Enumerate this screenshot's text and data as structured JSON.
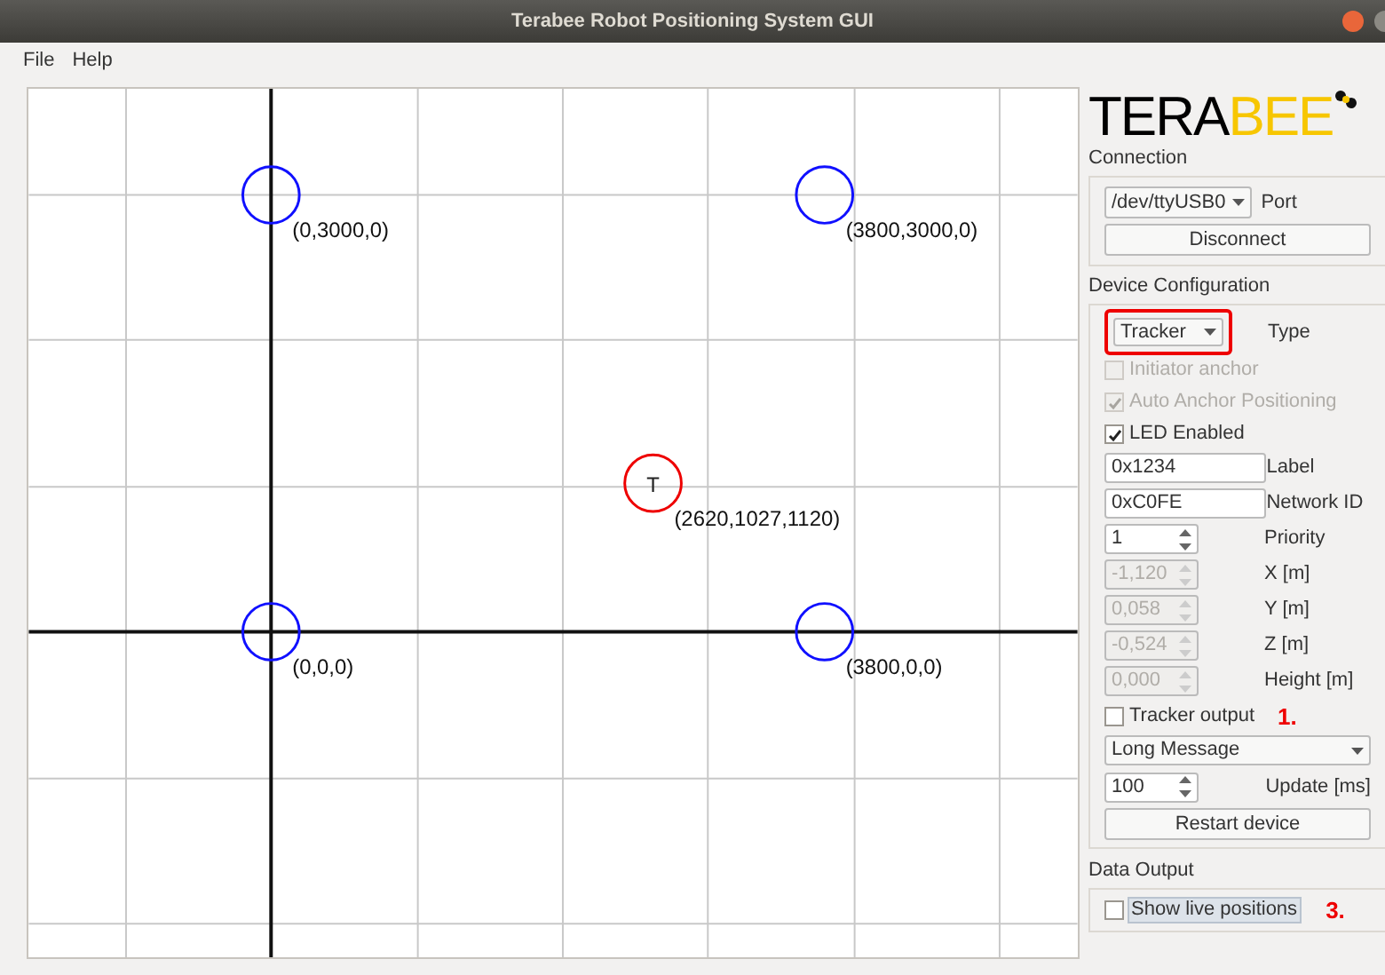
{
  "window": {
    "title": "Terabee Robot Positioning System GUI"
  },
  "menu": [
    "File",
    "Help"
  ],
  "canvas": {
    "anchors": [
      {
        "label": "(0,3000,0)"
      },
      {
        "label": "(3800,3000,0)"
      },
      {
        "label": "(0,0,0)"
      },
      {
        "label": "(3800,0,0)"
      }
    ],
    "tracker": {
      "symbol": "T",
      "label": "(2620,1027,1120)"
    }
  },
  "logo": {
    "dark": "TERA",
    "accent": "BEE"
  },
  "connection": {
    "title": "Connection",
    "port_value": "/dev/ttyUSB0",
    "port_label": "Port",
    "button": "Disconnect"
  },
  "device": {
    "title": "Device Configuration",
    "type_value": "Tracker",
    "type_label": "Type",
    "type_highlighted": true,
    "checks": [
      {
        "label": "Initiator anchor",
        "checked": false,
        "disabled": true
      },
      {
        "label": "Auto Anchor Positioning",
        "checked": true,
        "disabled": true
      },
      {
        "label": "LED Enabled",
        "checked": true,
        "disabled": false
      }
    ],
    "fields": [
      {
        "kind": "text",
        "value": "0x1234",
        "label": "Label",
        "disabled": false
      },
      {
        "kind": "text",
        "value": "0xC0FE",
        "label": "Network ID",
        "disabled": false
      },
      {
        "kind": "spin",
        "value": "1",
        "label": "Priority",
        "disabled": false
      },
      {
        "kind": "spin",
        "value": "-1,120",
        "label": "X [m]",
        "disabled": true
      },
      {
        "kind": "spin",
        "value": "0,058",
        "label": "Y [m]",
        "disabled": true
      },
      {
        "kind": "spin",
        "value": "-0,524",
        "label": "Z [m]",
        "disabled": true
      },
      {
        "kind": "spin",
        "value": "0,000",
        "label": "Height [m]",
        "disabled": true
      }
    ],
    "tracker_output": {
      "label": "Tracker output",
      "checked": false,
      "note": "1."
    },
    "message_value": "Long Message",
    "update": {
      "value": "100",
      "label": "Update [ms]"
    },
    "button": "Restart device"
  },
  "data_output": {
    "title": "Data Output",
    "label": "Show live positions",
    "checked": false,
    "note": "3."
  }
}
